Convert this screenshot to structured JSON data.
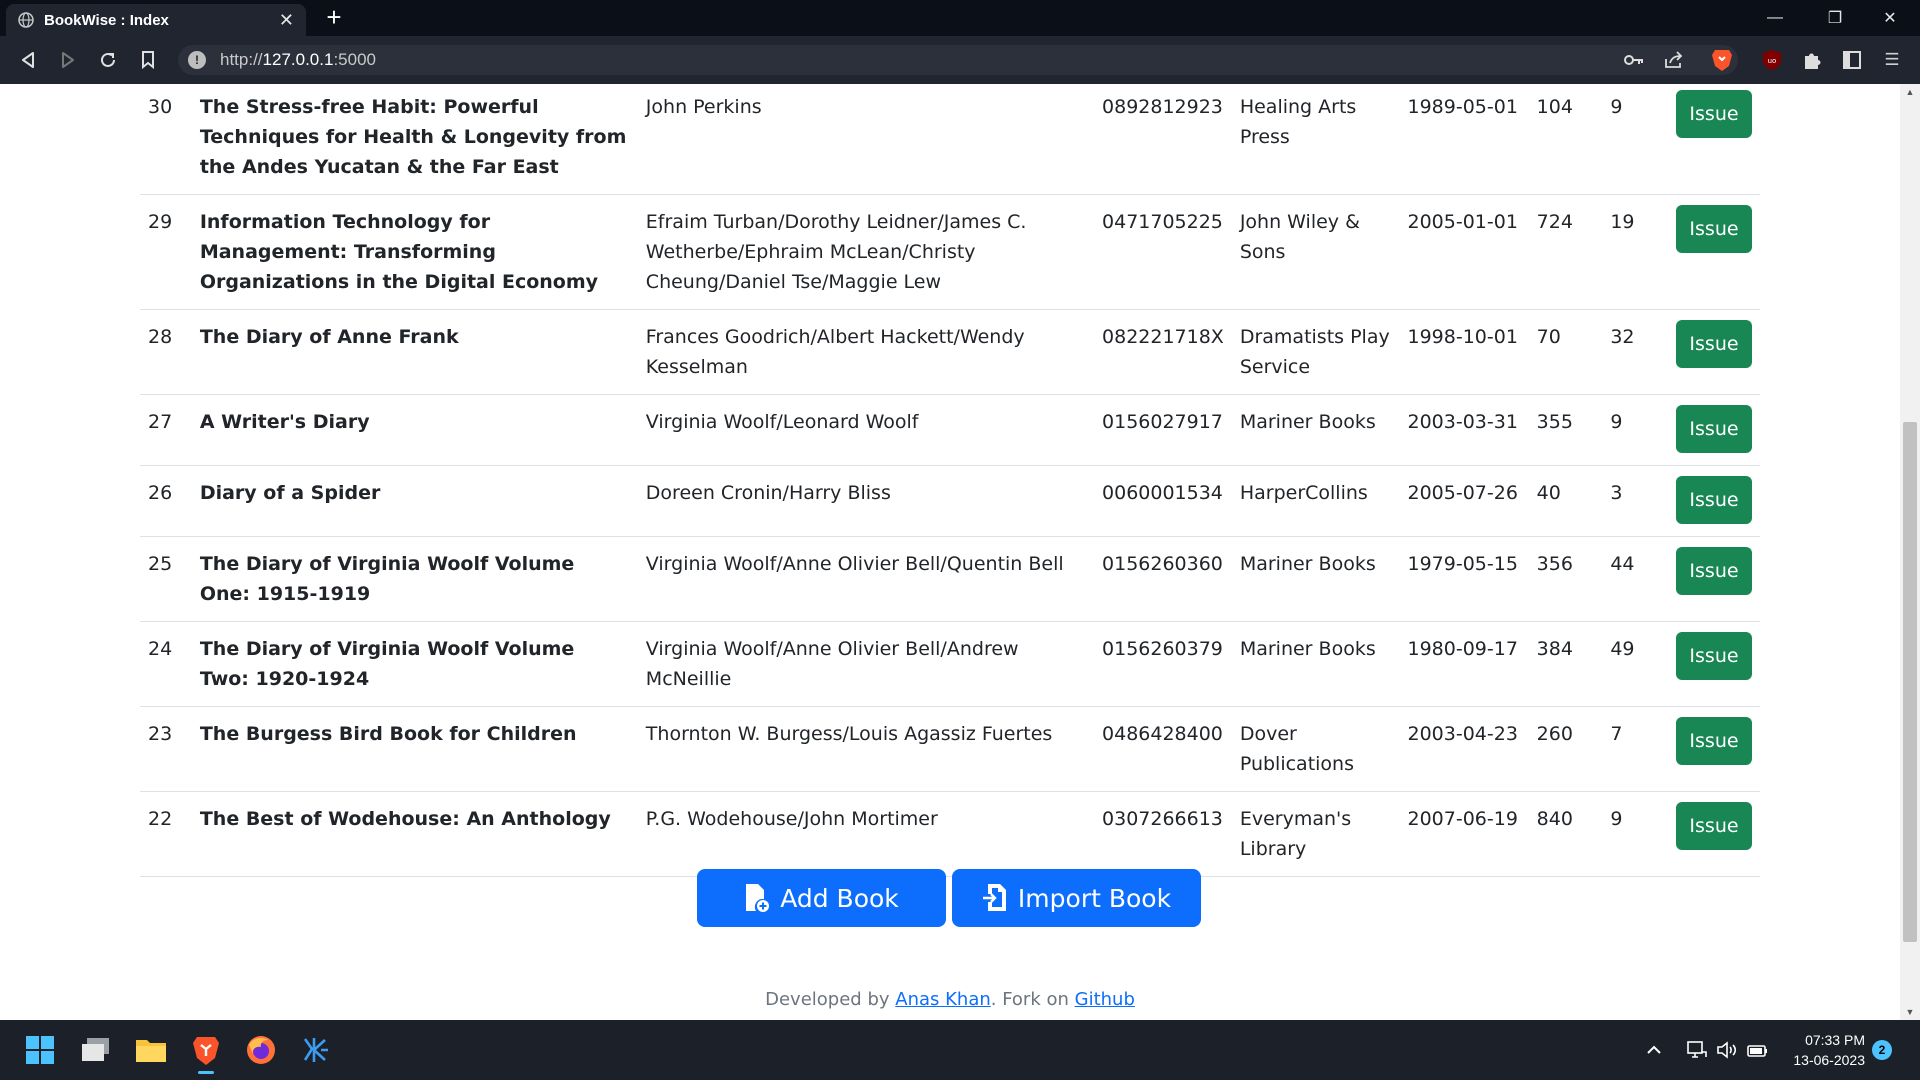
{
  "browser": {
    "tab_title": "BookWise : Index",
    "url_prefix": "http://",
    "url_host": "127.0.0.1",
    "url_port": ":5000"
  },
  "books": [
    {
      "id": "30",
      "title": "The Stress-free Habit: Powerful Techniques for Health & Longevity from the Andes Yucatan & the Far East",
      "authors": "John Perkins",
      "isbn": "0892812923",
      "publisher": "Healing Arts Press",
      "date": "1989-05-01",
      "pages": "104",
      "qty": "9",
      "action": "Issue"
    },
    {
      "id": "29",
      "title": "Information Technology for Management: Transforming Organizations in the Digital Economy",
      "authors": "Efraim Turban/Dorothy Leidner/James C. Wetherbe/Ephraim McLean/Christy Cheung/Daniel Tse/Maggie Lew",
      "isbn": "0471705225",
      "publisher": "John Wiley & Sons",
      "date": "2005-01-01",
      "pages": "724",
      "qty": "19",
      "action": "Issue"
    },
    {
      "id": "28",
      "title": "The Diary of Anne Frank",
      "authors": "Frances Goodrich/Albert Hackett/Wendy Kesselman",
      "isbn": "082221718X",
      "publisher": "Dramatists Play Service",
      "date": "1998-10-01",
      "pages": "70",
      "qty": "32",
      "action": "Issue"
    },
    {
      "id": "27",
      "title": "A Writer's Diary",
      "authors": "Virginia Woolf/Leonard Woolf",
      "isbn": "0156027917",
      "publisher": "Mariner Books",
      "date": "2003-03-31",
      "pages": "355",
      "qty": "9",
      "action": "Issue"
    },
    {
      "id": "26",
      "title": "Diary of a Spider",
      "authors": "Doreen Cronin/Harry Bliss",
      "isbn": "0060001534",
      "publisher": "HarperCollins",
      "date": "2005-07-26",
      "pages": "40",
      "qty": "3",
      "action": "Issue"
    },
    {
      "id": "25",
      "title": "The Diary of Virginia Woolf Volume One: 1915-1919",
      "authors": "Virginia Woolf/Anne Olivier Bell/Quentin Bell",
      "isbn": "0156260360",
      "publisher": "Mariner Books",
      "date": "1979-05-15",
      "pages": "356",
      "qty": "44",
      "action": "Issue"
    },
    {
      "id": "24",
      "title": "The Diary of Virginia Woolf Volume Two: 1920-1924",
      "authors": "Virginia Woolf/Anne Olivier Bell/Andrew McNeillie",
      "isbn": "0156260379",
      "publisher": "Mariner Books",
      "date": "1980-09-17",
      "pages": "384",
      "qty": "49",
      "action": "Issue"
    },
    {
      "id": "23",
      "title": "The Burgess Bird Book for Children",
      "authors": "Thornton W. Burgess/Louis Agassiz Fuertes",
      "isbn": "0486428400",
      "publisher": "Dover Publications",
      "date": "2003-04-23",
      "pages": "260",
      "qty": "7",
      "action": "Issue"
    },
    {
      "id": "22",
      "title": "The Best of Wodehouse: An Anthology",
      "authors": "P.G. Wodehouse/John Mortimer",
      "isbn": "0307266613",
      "publisher": "Everyman's Library",
      "date": "2007-06-19",
      "pages": "840",
      "qty": "9",
      "action": "Issue"
    }
  ],
  "actions": {
    "add_book": "Add Book",
    "import_book": "Import Book"
  },
  "footer": {
    "developed_by": "Developed by ",
    "author_link": "Anas Khan",
    "fork_text": ". Fork on ",
    "github_link": "Github"
  },
  "taskbar": {
    "time": "07:33 PM",
    "date": "13-06-2023",
    "notifications": "2"
  },
  "colors": {
    "issue_button": "#198754",
    "primary_button": "#0d6efd",
    "link": "#0d6efd"
  }
}
